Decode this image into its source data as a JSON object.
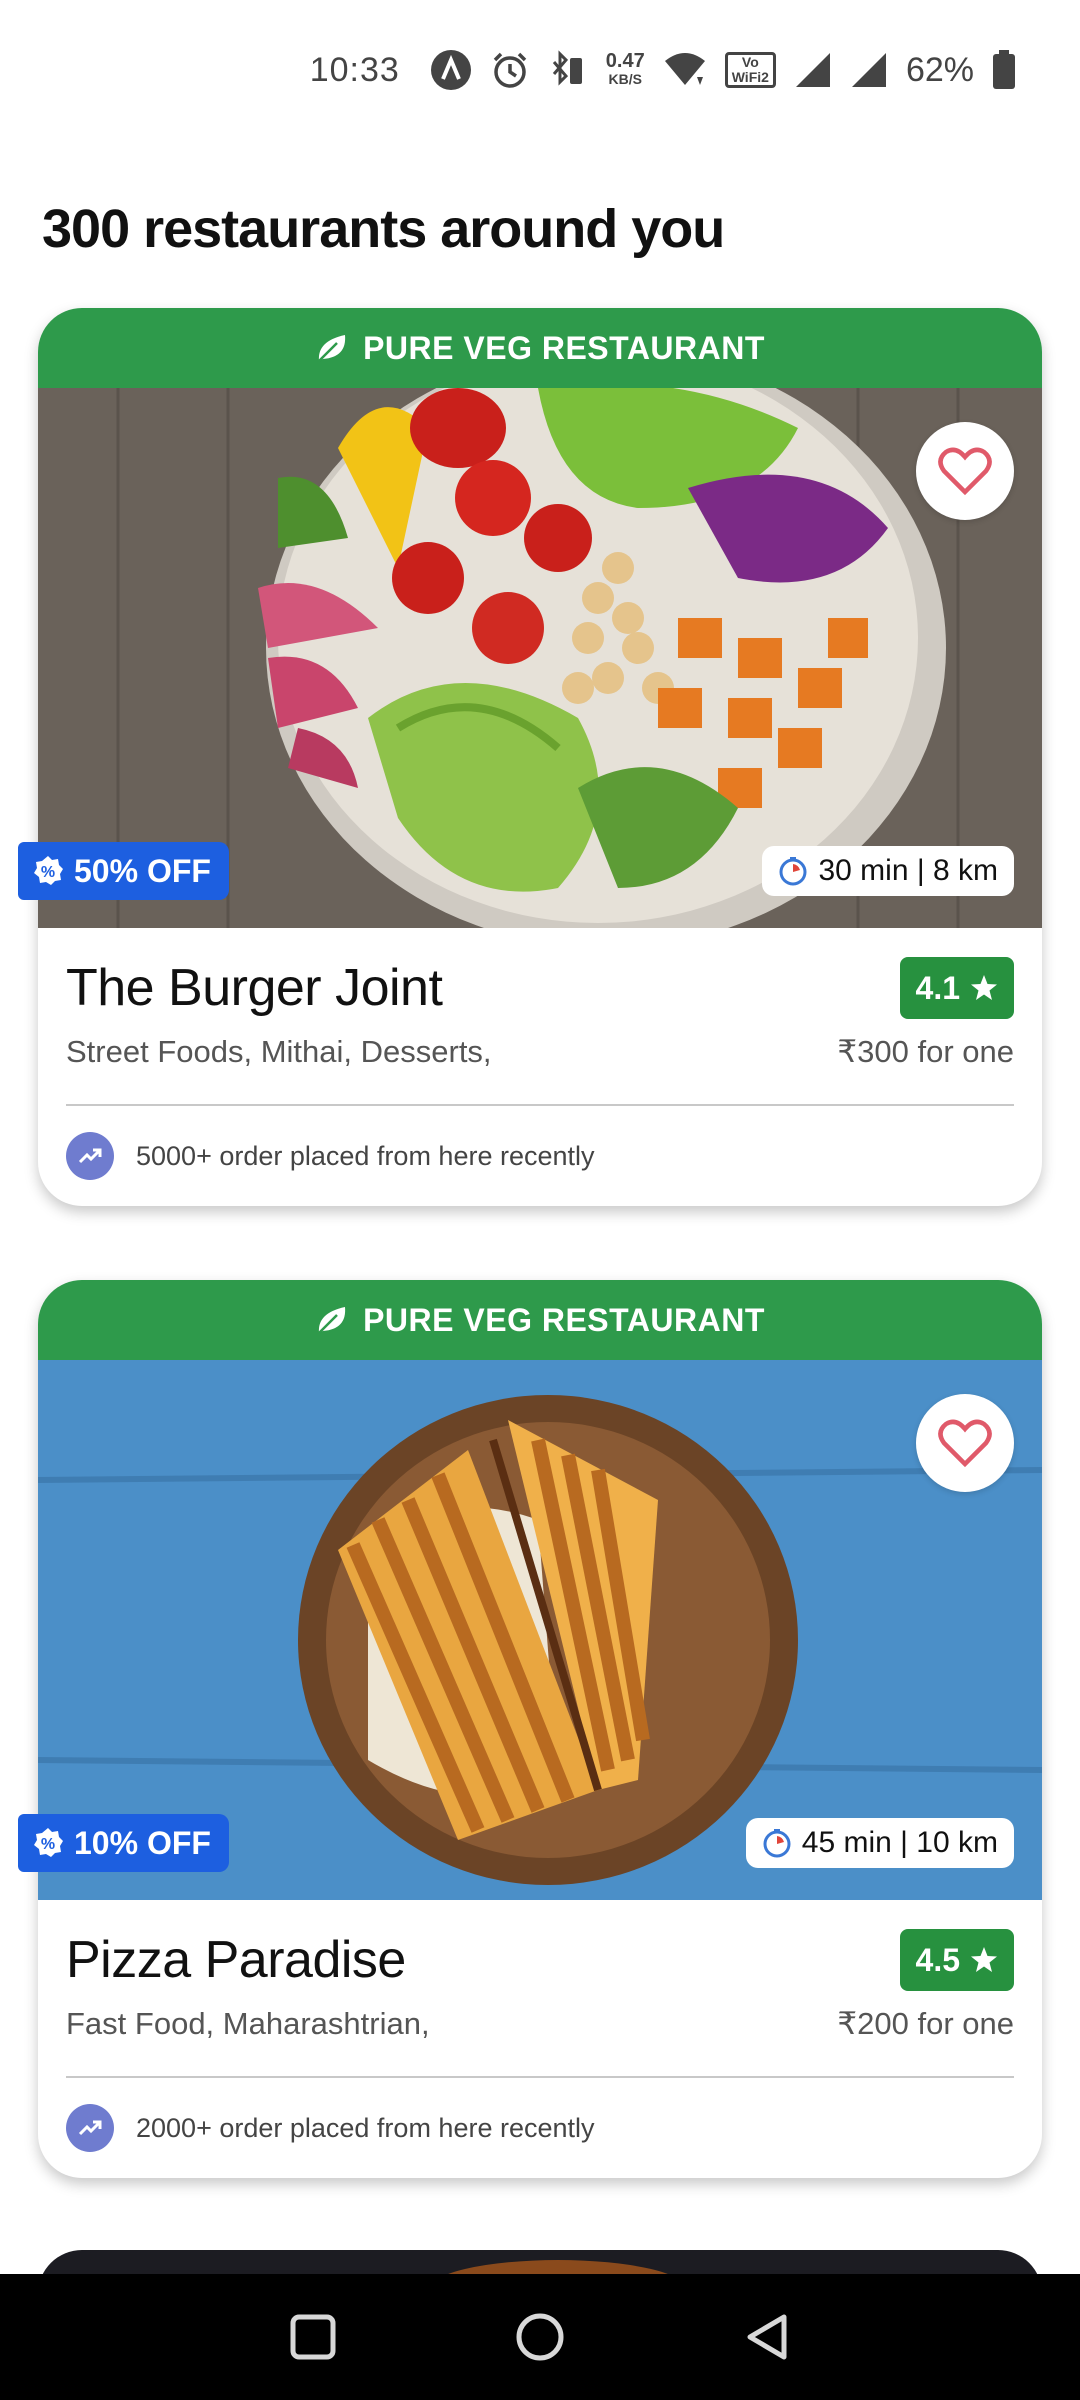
{
  "status_bar": {
    "time": "10:33",
    "net_speed_top": "0.47",
    "net_speed_bottom": "KB/S",
    "vo_label": "Vo",
    "wifi_label": "WiFi2",
    "battery": "62%"
  },
  "page": {
    "title": "300 restaurants around you"
  },
  "restaurants": [
    {
      "banner": "PURE VEG RESTAURANT",
      "discount": "50% OFF",
      "eta": "30 min | 8 km",
      "name": "The Burger Joint",
      "rating": "4.1",
      "cuisines": "Street Foods, Mithai, Desserts,",
      "price": "₹300 for one",
      "orders": "5000+ order placed from here recently",
      "image": "salad-bowl"
    },
    {
      "banner": "PURE VEG RESTAURANT",
      "discount": "10% OFF",
      "eta": "45 min | 10 km",
      "name": "Pizza Paradise",
      "rating": "4.5",
      "cuisines": "Fast Food, Maharashtrian,",
      "price": "₹200 for one",
      "orders": "2000+ order placed from here recently",
      "image": "grilled-sandwich"
    }
  ],
  "colors": {
    "veg_green": "#2e9a4b",
    "rating_green": "#27913f",
    "discount_blue": "#1d5fe0",
    "heart_pink": "#e05a6a",
    "trend_purple": "#6f7ccf"
  }
}
